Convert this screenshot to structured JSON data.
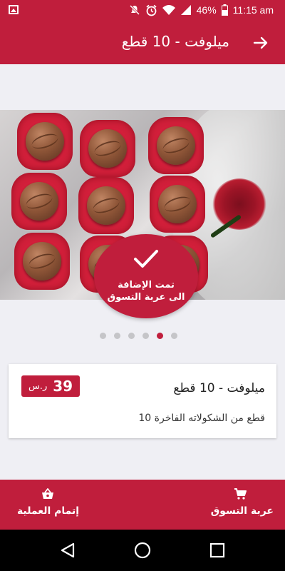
{
  "status_bar": {
    "battery": "46%",
    "time": "11:15 am",
    "icons": [
      "image-icon",
      "mute-icon",
      "alarm-icon",
      "wifi-icon",
      "signal-icon",
      "battery-icon"
    ]
  },
  "header": {
    "title": "ميلوفت - 10 قطع",
    "back_icon": "arrow-right-icon"
  },
  "gallery": {
    "slide_count": 6,
    "active_index": 4,
    "toast": {
      "line1": "تمت الإضافة",
      "line2": "الى عربة التسوق",
      "icon": "check-icon"
    }
  },
  "product": {
    "name": "ميلوفت - 10 قطع",
    "price": "39",
    "currency": "ر.س",
    "description": "10 قطع من الشكولاته الفاخرة"
  },
  "bottom_bar": {
    "cart_label": "عربة التسوق",
    "cart_icon": "cart-icon",
    "checkout_label": "إتمام العملية",
    "checkout_icon": "basket-icon"
  },
  "colors": {
    "primary": "#c01e3c",
    "background": "#efeff4"
  }
}
